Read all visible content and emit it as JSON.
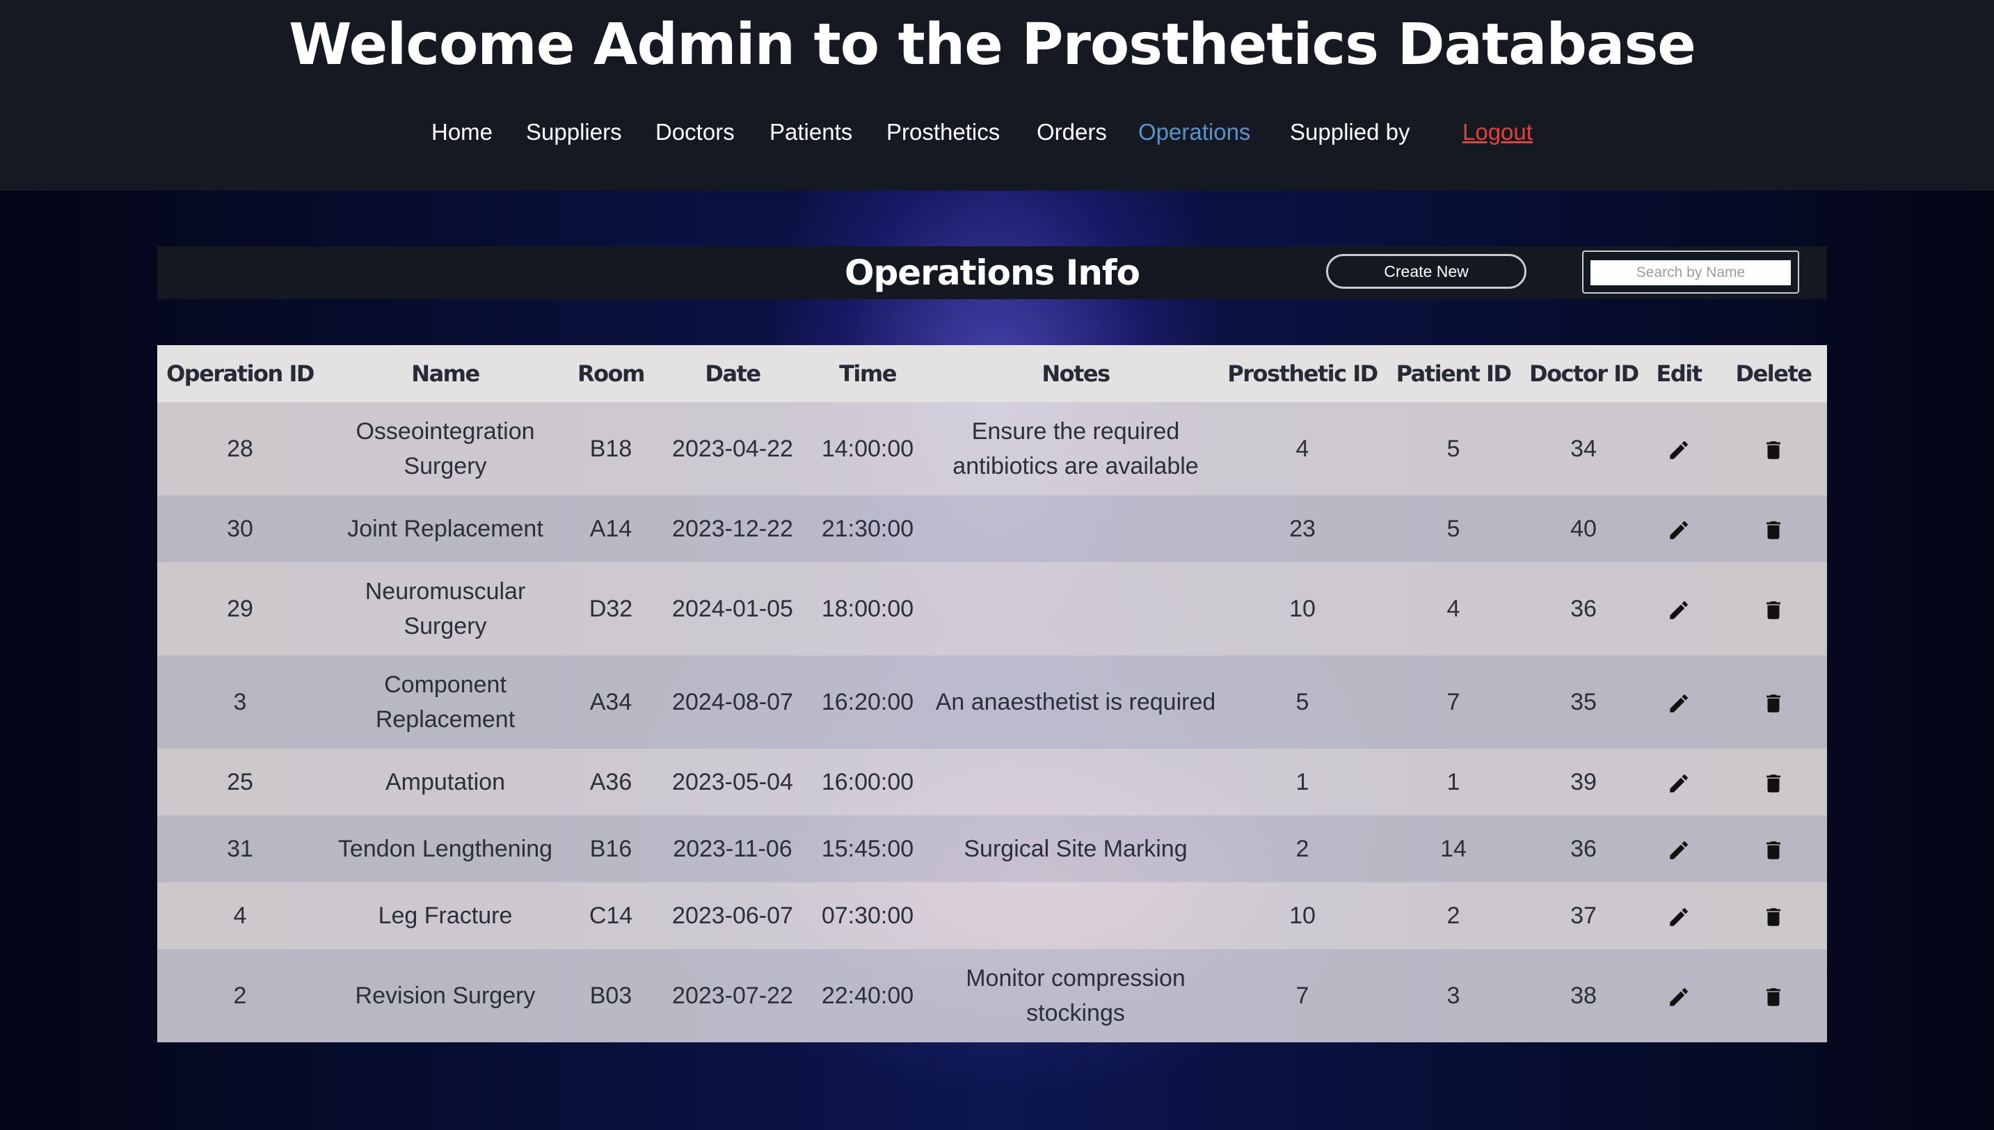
{
  "header": {
    "title": "Welcome Admin to the Prosthetics Database"
  },
  "nav": {
    "items": [
      "Home",
      "Suppliers",
      "Doctors",
      "Patients",
      "Prosthetics",
      "Orders",
      "Operations",
      "Supplied by"
    ],
    "active": "Operations",
    "logout": "Logout"
  },
  "toolbar": {
    "title": "Operations Info",
    "create_label": "Create New",
    "search_placeholder": "Search by Name"
  },
  "table": {
    "columns": [
      "Operation ID",
      "Name",
      "Room",
      "Date",
      "Time",
      "Notes",
      "Prosthetic ID",
      "Patient ID",
      "Doctor ID",
      "Edit",
      "Delete"
    ],
    "rows": [
      {
        "id": "28",
        "name": "Osseointegration Surgery",
        "room": "B18",
        "date": "2023-04-22",
        "time": "14:00:00",
        "notes": "Ensure the required antibiotics are available",
        "prosthetic_id": "4",
        "patient_id": "5",
        "doctor_id": "34"
      },
      {
        "id": "30",
        "name": "Joint Replacement",
        "room": "A14",
        "date": "2023-12-22",
        "time": "21:30:00",
        "notes": "",
        "prosthetic_id": "23",
        "patient_id": "5",
        "doctor_id": "40"
      },
      {
        "id": "29",
        "name": "Neuromuscular Surgery",
        "room": "D32",
        "date": "2024-01-05",
        "time": "18:00:00",
        "notes": "",
        "prosthetic_id": "10",
        "patient_id": "4",
        "doctor_id": "36"
      },
      {
        "id": "3",
        "name": "Component Replacement",
        "room": "A34",
        "date": "2024-08-07",
        "time": "16:20:00",
        "notes": "An anaesthetist is required",
        "prosthetic_id": "5",
        "patient_id": "7",
        "doctor_id": "35"
      },
      {
        "id": "25",
        "name": "Amputation",
        "room": "A36",
        "date": "2023-05-04",
        "time": "16:00:00",
        "notes": "",
        "prosthetic_id": "1",
        "patient_id": "1",
        "doctor_id": "39"
      },
      {
        "id": "31",
        "name": "Tendon Lengthening",
        "room": "B16",
        "date": "2023-11-06",
        "time": "15:45:00",
        "notes": "Surgical Site Marking",
        "prosthetic_id": "2",
        "patient_id": "14",
        "doctor_id": "36"
      },
      {
        "id": "4",
        "name": "Leg Fracture",
        "room": "C14",
        "date": "2023-06-07",
        "time": "07:30:00",
        "notes": "",
        "prosthetic_id": "10",
        "patient_id": "2",
        "doctor_id": "37"
      },
      {
        "id": "2",
        "name": "Revision Surgery",
        "room": "B03",
        "date": "2023-07-22",
        "time": "22:40:00",
        "notes": "Monitor compression stockings",
        "prosthetic_id": "7",
        "patient_id": "3",
        "doctor_id": "38"
      }
    ]
  },
  "icons": {
    "edit": "pencil-icon",
    "delete": "trash-icon"
  }
}
